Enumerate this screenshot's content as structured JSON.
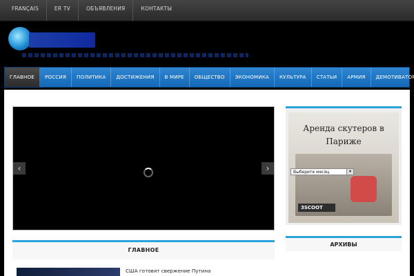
{
  "top_links": [
    "FRANÇAIS",
    "ER TV",
    "ОБЪЯВЛЕНИЯ",
    "КОНТАКТЫ"
  ],
  "nav_items": [
    "ГЛАВНОЕ",
    "РОССИЯ",
    "ПОЛИТИКА",
    "ДОСТИЖЕНИЯ",
    "В МИРЕ",
    "ОБЩЕСТВО",
    "ЭКОНОМИКА",
    "КУЛЬТУРА",
    "СТАТЬИ",
    "АРМИЯ",
    "ДЕМОТИВАТОРЫ"
  ],
  "ad": {
    "title": "Аренда скутеров в Париже",
    "brand": "3SCOOT"
  },
  "section": {
    "main_title": "ГЛАВНОЕ",
    "article_title": "США готовят свержение Путина"
  },
  "archive": {
    "title": "АРХИВЫ",
    "select_value": "Выберите месяц"
  },
  "colors": {
    "nav": "#1f78c5",
    "accent": "#2aa3dc",
    "active_nav": "#2b2b2b"
  }
}
